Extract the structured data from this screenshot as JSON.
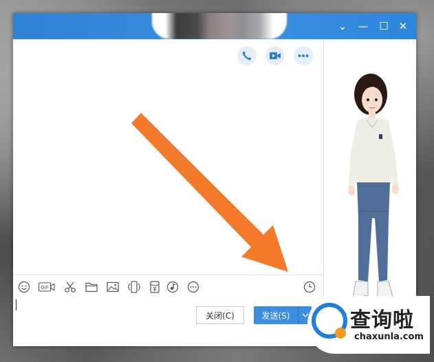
{
  "window": {
    "controls": {
      "dropdown_glyph": "⌄",
      "minimize_glyph": "—",
      "maximize_glyph": "☐",
      "close_glyph": "✕"
    }
  },
  "chat": {
    "header_actions": [
      "phone-icon",
      "video-call-icon",
      "more-icon"
    ],
    "toolbar": [
      "emoji-icon",
      "gif-icon",
      "screenshot-scissors-icon",
      "folder-icon",
      "image-icon",
      "shake-icon",
      "red-packet-icon",
      "music-icon",
      "more-circle-icon",
      "history-clock-icon"
    ],
    "gif_label": "GIF",
    "input_value": "",
    "close_label": "关闭(C)",
    "send_label": "发送(S)"
  },
  "colors": {
    "titlebar": "#3a8fe0",
    "send_button": "#3b8de0",
    "annotation_arrow": "#f27a2a"
  },
  "watermark": {
    "title": "查询啦",
    "subtitle": "chaxunla.com"
  }
}
